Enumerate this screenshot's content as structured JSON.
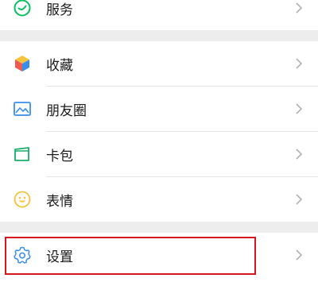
{
  "group_top": {
    "items": [
      {
        "label": "服务",
        "icon": "services-icon"
      }
    ]
  },
  "group_middle": {
    "items": [
      {
        "label": "收藏",
        "icon": "favorites-icon"
      },
      {
        "label": "朋友圈",
        "icon": "moments-icon"
      },
      {
        "label": "卡包",
        "icon": "cards-icon"
      },
      {
        "label": "表情",
        "icon": "stickers-icon"
      }
    ]
  },
  "group_bottom": {
    "items": [
      {
        "label": "设置",
        "icon": "settings-icon",
        "highlighted": true
      }
    ]
  },
  "colors": {
    "highlight_border": "#d6161e",
    "services_green": "#07c160",
    "favorites_red": "#f05b4f",
    "favorites_yellow": "#f6c33c",
    "favorites_blue": "#3b8fea",
    "moments_blue": "#3b8fea",
    "cards_green": "#1aad6a",
    "stickers_yellow": "#f6c33c",
    "settings_blue": "#3b8fea"
  }
}
